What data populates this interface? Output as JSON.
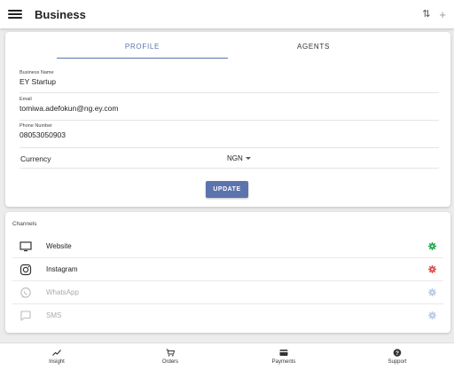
{
  "appbar": {
    "title": "Business",
    "sort_icon": "sort-icon",
    "add_icon": "plus-icon"
  },
  "profile": {
    "tabs": [
      {
        "label": "PROFILE",
        "active": true
      },
      {
        "label": "AGENTS",
        "active": false
      }
    ],
    "fields": {
      "business_name": {
        "label": "Business Name",
        "value": "EY Startup"
      },
      "email": {
        "label": "Email",
        "value": "tomiwa.adefokun@ng.ey.com"
      },
      "phone": {
        "label": "Phone Number",
        "value": "08053050903"
      }
    },
    "currency": {
      "label": "Currency",
      "value": "NGN"
    },
    "update_label": "UPDATE"
  },
  "channels": {
    "header": "Channels",
    "items": [
      {
        "label": "Website",
        "icon": "monitor-icon",
        "status_color": "#1faa4c",
        "enabled": true
      },
      {
        "label": "Instagram",
        "icon": "instagram-icon",
        "status_color": "#e04848",
        "enabled": true
      },
      {
        "label": "WhatsApp",
        "icon": "whatsapp-icon",
        "status_color": "#b8c8e6",
        "enabled": false
      },
      {
        "label": "SMS",
        "icon": "sms-icon",
        "status_color": "#b8c8e6",
        "enabled": false
      }
    ]
  },
  "bottom_nav": [
    {
      "label": "Insight",
      "icon": "trending-up-icon"
    },
    {
      "label": "Orders",
      "icon": "cart-icon"
    },
    {
      "label": "Payments",
      "icon": "credit-card-icon"
    },
    {
      "label": "Support",
      "icon": "help-icon"
    }
  ],
  "colors": {
    "accent": "#5b74ae",
    "background": "#ececec"
  }
}
